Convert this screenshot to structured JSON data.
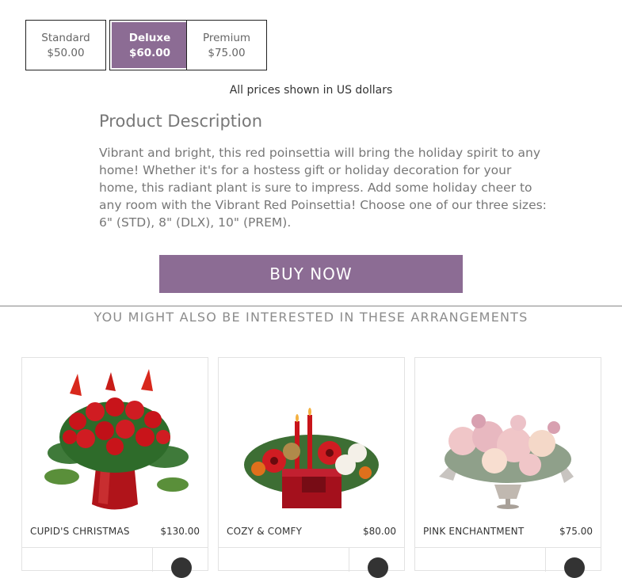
{
  "accent_color": "#8c6c94",
  "size_options": [
    {
      "name": "Standard",
      "price": "$50.00",
      "selected": false
    },
    {
      "name": "Deluxe",
      "price": "$60.00",
      "selected": true
    },
    {
      "name": "Premium",
      "price": "$75.00",
      "selected": false
    }
  ],
  "currency_note": "All prices shown in US dollars",
  "description": {
    "heading": "Product Description",
    "text": "Vibrant and bright, this red poinsettia will bring the holiday spirit to any home! Whether it's for a hostess gift or holiday decoration for your home, this radiant plant is sure to impress. Add some holiday cheer to any room with the Vibrant Red Poinsettia! Choose one of our three sizes: 6\" (STD), 8\" (DLX), 10\" (PREM)."
  },
  "buy_now_label": "BUY NOW",
  "related": {
    "heading": "YOU MIGHT ALSO BE INTERESTED IN THESE ARRANGEMENTS",
    "items": [
      {
        "name": "CUPID'S CHRISTMAS",
        "price": "$130.00",
        "icon": "cart-icon"
      },
      {
        "name": "COZY & COMFY",
        "price": "$80.00",
        "icon": "cart-icon"
      },
      {
        "name": "PINK ENCHANTMENT",
        "price": "$75.00",
        "icon": "cart-icon"
      }
    ]
  }
}
